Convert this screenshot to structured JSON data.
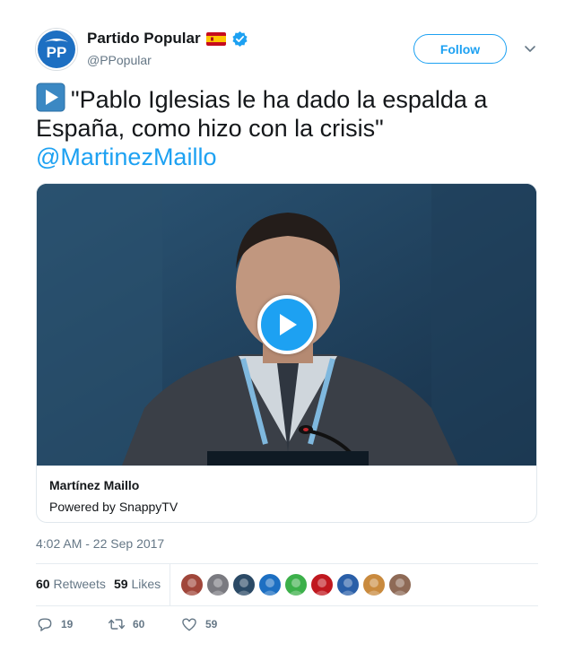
{
  "account": {
    "name": "Partido Popular",
    "handle": "@PPopular",
    "avatar_icon": "pp-logo-icon",
    "flag_icon": "spain-flag-icon",
    "verified_icon": "verified-badge-icon",
    "brand_color": "#1da1f2"
  },
  "follow": {
    "label": "Follow"
  },
  "menu": {
    "icon": "chevron-down-icon"
  },
  "tweet": {
    "emoji_icon": "play-emoji-icon",
    "text": "\"Pablo Iglesias le ha dado la espalda a España, como hizo con la crisis\"",
    "mention": "@MartinezMaillo"
  },
  "card": {
    "title": "Martínez Maillo",
    "subtitle": "Powered by SnappyTV",
    "play_icon": "play-icon"
  },
  "timestamp": "4:02 AM - 22 Sep 2017",
  "stats": {
    "retweets_count": "60",
    "retweets_label": "Retweets",
    "likes_count": "59",
    "likes_label": "Likes",
    "faces": [
      {
        "name": "user-avatar-1",
        "color": "#a0463a"
      },
      {
        "name": "user-avatar-2",
        "color": "#7a7a80"
      },
      {
        "name": "user-avatar-3",
        "color": "#2b4a66"
      },
      {
        "name": "pp-avatar",
        "color": "#1d6fc2"
      },
      {
        "name": "green-logo-avatar",
        "color": "#3cb04a"
      },
      {
        "name": "red-logo-avatar",
        "color": "#c0181f"
      },
      {
        "name": "pp-small-avatar",
        "color": "#2a5fa8"
      },
      {
        "name": "user-avatar-4",
        "color": "#c98a3e"
      },
      {
        "name": "user-avatar-5",
        "color": "#8e6a56"
      }
    ]
  },
  "actions": {
    "reply_count": "19",
    "retweet_count": "60",
    "like_count": "59"
  }
}
